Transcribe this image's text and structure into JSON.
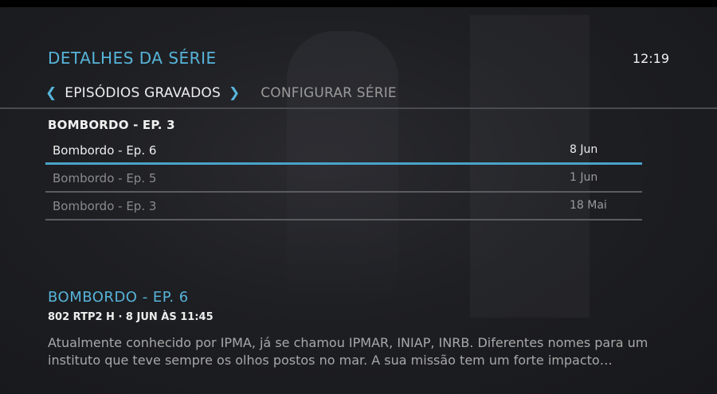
{
  "header": {
    "title": "DETALHES DA SÉRIE",
    "clock": "12:19"
  },
  "tabs": [
    {
      "label": "EPISÓDIOS GRAVADOS",
      "active": true
    },
    {
      "label": "CONFIGURAR SÉRIE",
      "active": false
    }
  ],
  "icons": {
    "prev": "chevron-left-icon",
    "next": "chevron-right-icon"
  },
  "colors": {
    "accent": "#57b4d9",
    "selection": "#4aa3c8",
    "background": "#1e1f23"
  },
  "series": {
    "heading": "BOMBORDO - EP. 3",
    "episodes": [
      {
        "title": "Bombordo - Ep. 6",
        "date": "8 Jun",
        "selected": true
      },
      {
        "title": "Bombordo - Ep. 5",
        "date": "1 Jun",
        "selected": false
      },
      {
        "title": "Bombordo - Ep. 3",
        "date": "18 Mai",
        "selected": false
      }
    ]
  },
  "detail": {
    "title": "BOMBORDO - EP. 6",
    "meta": "802 RTP2 H · 8 JUN ÀS 11:45",
    "description": "Atualmente conhecido por IPMA, já se chamou IPMAR, INIAP, INRB. Diferentes nomes para um instituto que teve sempre os olhos postos no mar. A sua missão tem um forte impacto…"
  }
}
